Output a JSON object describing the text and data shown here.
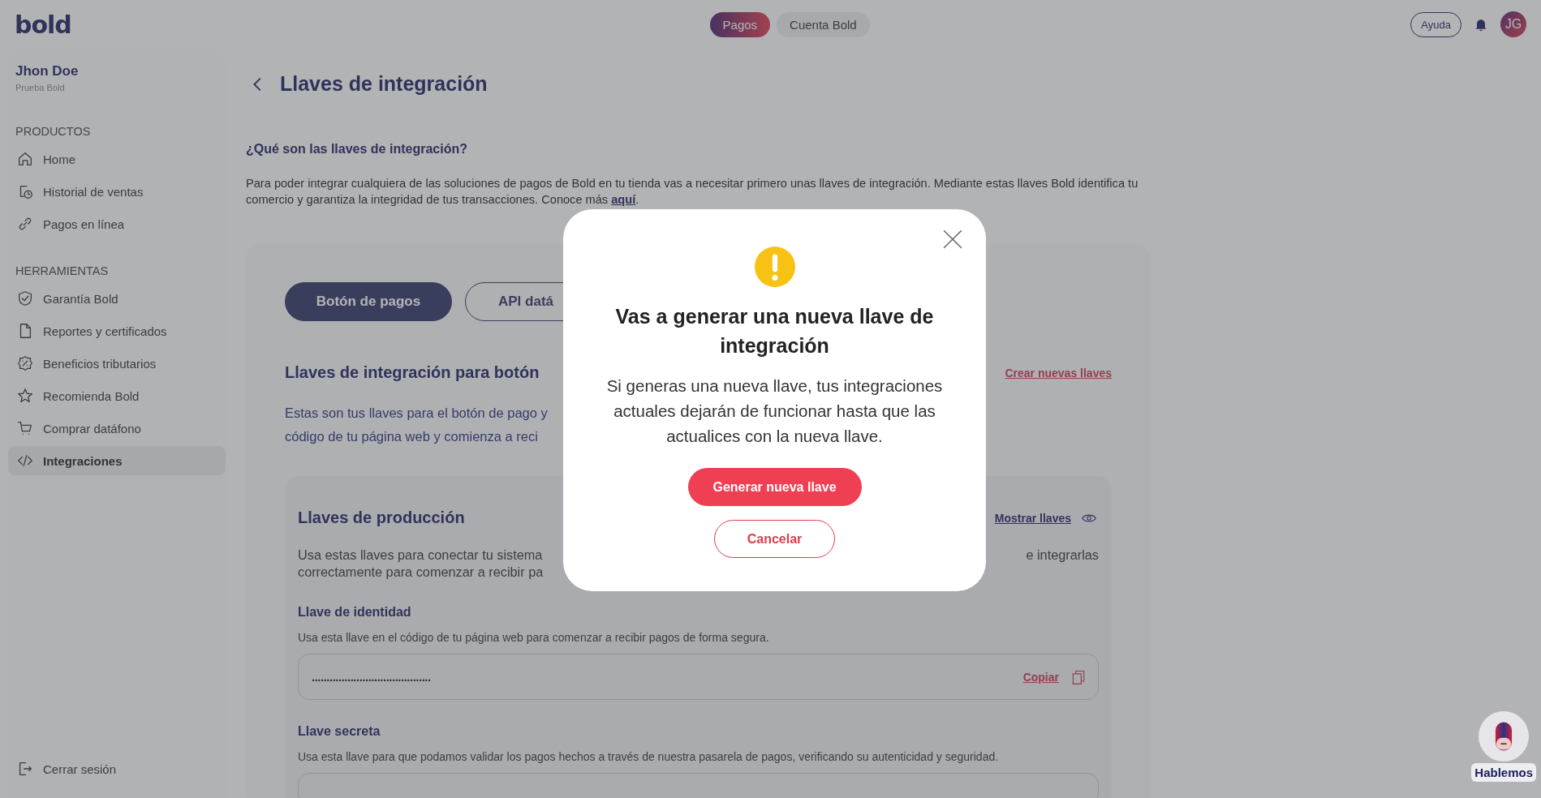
{
  "topbar": {
    "logo": "bold",
    "tabs": [
      {
        "label": "Pagos",
        "selected": true
      },
      {
        "label": "Cuenta Bold",
        "selected": false
      }
    ],
    "help_button": "Ayuda",
    "avatar": "JG"
  },
  "sidebar": {
    "user_name": "Jhon Doe",
    "user_subtitle": "Prueba Bold",
    "sections": [
      {
        "title": "PRODUCTOS",
        "items": [
          {
            "label": "Home",
            "selected": false
          },
          {
            "label": "Historial de ventas",
            "selected": false
          },
          {
            "label": "Pagos en línea",
            "selected": false
          }
        ]
      },
      {
        "title": "HERRAMIENTAS",
        "items": [
          {
            "label": "Garantía Bold",
            "selected": false
          },
          {
            "label": "Reportes y certificados",
            "selected": false
          },
          {
            "label": "Beneficios tributarios",
            "selected": false
          },
          {
            "label": "Recomienda Bold",
            "selected": false
          },
          {
            "label": "Comprar datáfono",
            "selected": false
          },
          {
            "label": "Integraciones",
            "selected": true
          }
        ]
      }
    ],
    "logout": "Cerrar sesión"
  },
  "page": {
    "title": "Llaves de integración",
    "intro_heading": "¿Qué son las llaves de integración?",
    "intro_text": "Para poder integrar cualquiera de las soluciones de pagos de Bold en tu tienda vas a necesitar primero unas llaves de integración. Mediante estas llaves Bold identifica tu comercio y garantiza la integridad de tus transacciones. Conoce más ",
    "intro_link": "aquí",
    "intro_end": ".",
    "tabs": [
      {
        "label": "Botón de pagos",
        "selected": true
      },
      {
        "label": "API datá",
        "selected": false
      }
    ],
    "section_title": "Llaves de integración para botón",
    "create_link": "Crear nuevas llaves",
    "section_text_lines": [
      "Estas son tus llaves para el botón de pago y",
      "código de tu página web y comienza a reci"
    ],
    "production": {
      "title": "Llaves de producción",
      "show_link": "Mostrar llaves",
      "text_left_lines": [
        "Usa estas llaves para conectar tu sistema",
        "correctamente para comenzar a recibir pa"
      ],
      "text_right": "e integrarlas",
      "keys": [
        {
          "label": "Llave de identidad",
          "description": "Usa esta llave en el código de tu página web para comenzar a recibir pagos de forma segura.",
          "value": "........................................",
          "copy": "Copiar"
        },
        {
          "label": "Llave secreta",
          "description": "Usa esta llave para que podamos validar los pagos hechos a través de nuestra pasarela de pagos, verificando su autenticidad y seguridad."
        }
      ]
    }
  },
  "modal": {
    "title": "Vas a generar una nueva llave de integración",
    "message": "Si generas una nueva llave, tus integraciones actuales dejarán de funcionar hasta que las actualices con la nueva llave.",
    "primary_button": "Generar nueva llave",
    "secondary_button": "Cancelar"
  },
  "chat": {
    "label": "Hablemos"
  }
}
